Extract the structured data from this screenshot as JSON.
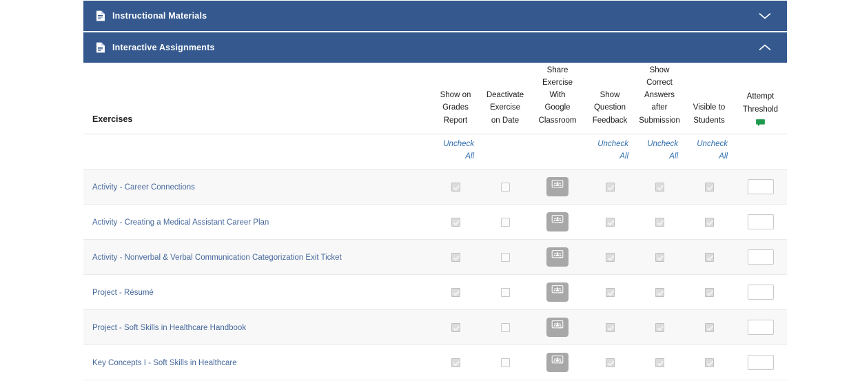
{
  "sections": [
    {
      "title": "Instructional Materials",
      "icon": "document-icon",
      "expanded": false,
      "chevron": "chevron-down-icon"
    },
    {
      "title": "Interactive Assignments",
      "icon": "document-icon",
      "expanded": true,
      "chevron": "chevron-up-icon"
    }
  ],
  "colors": {
    "header_blue": "#35598f",
    "link_blue": "#46689c",
    "uncheck_link_blue": "#2f6fad",
    "row_stripe": "#f8f8f8",
    "comment_green": "#1e9a4e"
  },
  "table": {
    "columns": [
      {
        "key": "name",
        "label": "Exercises",
        "lines": [
          "Exercises"
        ]
      },
      {
        "key": "grades",
        "label": "Show on Grades Report",
        "lines": [
          "Show on",
          "Grades",
          "Report"
        ]
      },
      {
        "key": "deact",
        "label": "Deactivate Exercise on Date",
        "lines": [
          "Deactivate",
          "Exercise",
          "on Date"
        ]
      },
      {
        "key": "gclass",
        "label": "Share Exercise With Google Classroom",
        "lines": [
          "Share",
          "Exercise",
          "With",
          "Google",
          "Classroom"
        ]
      },
      {
        "key": "feedback",
        "label": "Show Question Feedback",
        "lines": [
          "Show",
          "Question",
          "Feedback"
        ]
      },
      {
        "key": "answers",
        "label": "Show Correct Answers after Submission",
        "lines": [
          "Show",
          "Correct",
          "Answers",
          "after",
          "Submission"
        ]
      },
      {
        "key": "visible",
        "label": "Visible to Students",
        "lines": [
          "Visible to",
          "Students"
        ]
      },
      {
        "key": "attempt",
        "label": "Attempt Threshold",
        "lines": [
          "Attempt",
          "Threshold"
        ],
        "icon": "comment-bubble-icon"
      }
    ],
    "uncheck_all": {
      "label": "Uncheck All",
      "line1": "Uncheck",
      "line2": "All",
      "columns": [
        "grades",
        "feedback",
        "answers",
        "visible"
      ]
    },
    "rows": [
      {
        "name": "Activity - Career Connections",
        "grades": true,
        "deact": false,
        "gclass": "google-classroom-share-button",
        "feedback": true,
        "answers": true,
        "visible": true,
        "attempt": ""
      },
      {
        "name": "Activity - Creating a Medical Assistant Career Plan",
        "grades": true,
        "deact": false,
        "gclass": "google-classroom-share-button",
        "feedback": true,
        "answers": true,
        "visible": true,
        "attempt": ""
      },
      {
        "name": "Activity - Nonverbal & Verbal Communication Categorization Exit Ticket",
        "grades": true,
        "deact": false,
        "gclass": "google-classroom-share-button",
        "feedback": true,
        "answers": true,
        "visible": true,
        "attempt": ""
      },
      {
        "name": "Project - Résumé",
        "grades": true,
        "deact": false,
        "gclass": "google-classroom-share-button",
        "feedback": true,
        "answers": true,
        "visible": true,
        "attempt": ""
      },
      {
        "name": "Project - Soft Skills in Healthcare Handbook",
        "grades": true,
        "deact": false,
        "gclass": "google-classroom-share-button",
        "feedback": true,
        "answers": true,
        "visible": true,
        "attempt": ""
      },
      {
        "name": "Key Concepts I - Soft Skills in Healthcare",
        "grades": true,
        "deact": false,
        "gclass": "google-classroom-share-button",
        "feedback": true,
        "answers": true,
        "visible": true,
        "attempt": ""
      }
    ]
  }
}
